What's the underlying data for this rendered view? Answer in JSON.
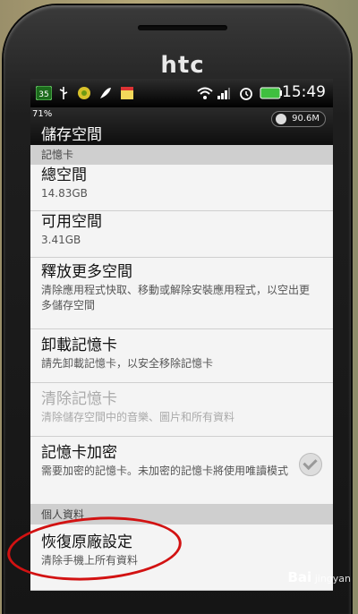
{
  "device": {
    "brand": "htc"
  },
  "status_bar": {
    "time": "15:49",
    "left_icons": [
      "sim-35-icon",
      "usb-icon",
      "android-icon",
      "feather-icon",
      "calendar-icon"
    ],
    "right_icons": [
      "wifi-icon",
      "signal-icon",
      "alarm-icon",
      "battery-icon"
    ],
    "sim_badge": "35"
  },
  "title_bar": {
    "battery_percent": "71%",
    "title": "儲存空間",
    "memory": "90.6M"
  },
  "sections": [
    {
      "header": "記憶卡"
    },
    {
      "header": "個人資料"
    }
  ],
  "items": [
    {
      "title": "總空間",
      "subtitle": "14.83GB"
    },
    {
      "title": "可用空間",
      "subtitle": "3.41GB"
    },
    {
      "title": "釋放更多空間",
      "subtitle": "清除應用程式快取、移動或解除安裝應用程式，以空出更多儲存空間"
    },
    {
      "title": "卸載記憶卡",
      "subtitle": "請先卸載記憶卡，以安全移除記憶卡"
    },
    {
      "title": "清除記憶卡",
      "subtitle": "清除儲存空間中的音樂、圖片和所有資料"
    },
    {
      "title": "記憶卡加密",
      "subtitle": "需要加密的記憶卡。未加密的記憶卡將使用唯讀模式"
    },
    {
      "title": "恢復原廠設定",
      "subtitle": "清除手機上所有資料"
    }
  ],
  "watermark": {
    "logo": "Bai",
    "text": "jingyan"
  }
}
